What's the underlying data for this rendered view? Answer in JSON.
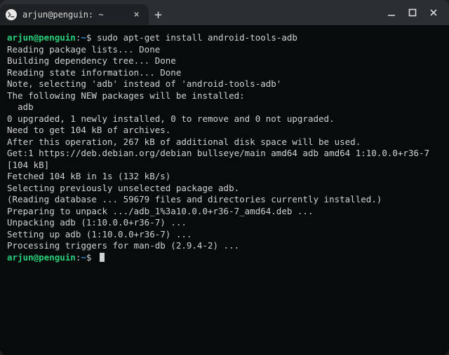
{
  "window": {
    "tab_title": "arjun@penguin: ~",
    "minimize_label": "Minimize",
    "maximize_label": "Maximize",
    "close_label": "Close"
  },
  "prompt": {
    "user_host": "arjun@penguin",
    "separator": ":",
    "path": "~",
    "symbol": "$"
  },
  "commands": {
    "install": "sudo apt-get install android-tools-adb"
  },
  "output": {
    "lines": [
      "Reading package lists... Done",
      "Building dependency tree... Done",
      "Reading state information... Done",
      "Note, selecting 'adb' instead of 'android-tools-adb'",
      "The following NEW packages will be installed:",
      "  adb",
      "0 upgraded, 1 newly installed, 0 to remove and 0 not upgraded.",
      "Need to get 104 kB of archives.",
      "After this operation, 267 kB of additional disk space will be used.",
      "Get:1 https://deb.debian.org/debian bullseye/main amd64 adb amd64 1:10.0.0+r36-7 [104 kB]",
      "Fetched 104 kB in 1s (132 kB/s)",
      "Selecting previously unselected package adb.",
      "(Reading database ... 59679 files and directories currently installed.)",
      "Preparing to unpack .../adb_1%3a10.0.0+r36-7_amd64.deb ...",
      "Unpacking adb (1:10.0.0+r36-7) ...",
      "Setting up adb (1:10.0.0+r36-7) ...",
      "Processing triggers for man-db (2.9.4-2) ..."
    ]
  },
  "icons": {
    "terminal": "terminal-icon",
    "close_tab": "×",
    "new_tab": "+"
  }
}
